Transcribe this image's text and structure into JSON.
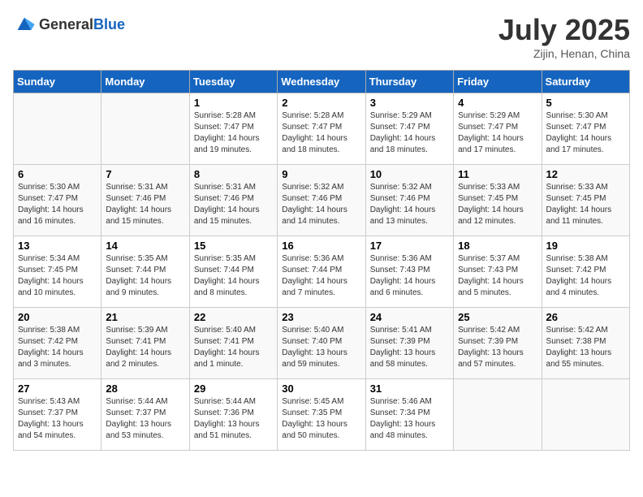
{
  "header": {
    "logo_general": "General",
    "logo_blue": "Blue",
    "title": "July 2025",
    "location": "Zijin, Henan, China"
  },
  "weekdays": [
    "Sunday",
    "Monday",
    "Tuesday",
    "Wednesday",
    "Thursday",
    "Friday",
    "Saturday"
  ],
  "weeks": [
    [
      {
        "day": "",
        "sunrise": "",
        "sunset": "",
        "daylight": ""
      },
      {
        "day": "",
        "sunrise": "",
        "sunset": "",
        "daylight": ""
      },
      {
        "day": "1",
        "sunrise": "Sunrise: 5:28 AM",
        "sunset": "Sunset: 7:47 PM",
        "daylight": "Daylight: 14 hours and 19 minutes."
      },
      {
        "day": "2",
        "sunrise": "Sunrise: 5:28 AM",
        "sunset": "Sunset: 7:47 PM",
        "daylight": "Daylight: 14 hours and 18 minutes."
      },
      {
        "day": "3",
        "sunrise": "Sunrise: 5:29 AM",
        "sunset": "Sunset: 7:47 PM",
        "daylight": "Daylight: 14 hours and 18 minutes."
      },
      {
        "day": "4",
        "sunrise": "Sunrise: 5:29 AM",
        "sunset": "Sunset: 7:47 PM",
        "daylight": "Daylight: 14 hours and 17 minutes."
      },
      {
        "day": "5",
        "sunrise": "Sunrise: 5:30 AM",
        "sunset": "Sunset: 7:47 PM",
        "daylight": "Daylight: 14 hours and 17 minutes."
      }
    ],
    [
      {
        "day": "6",
        "sunrise": "Sunrise: 5:30 AM",
        "sunset": "Sunset: 7:47 PM",
        "daylight": "Daylight: 14 hours and 16 minutes."
      },
      {
        "day": "7",
        "sunrise": "Sunrise: 5:31 AM",
        "sunset": "Sunset: 7:46 PM",
        "daylight": "Daylight: 14 hours and 15 minutes."
      },
      {
        "day": "8",
        "sunrise": "Sunrise: 5:31 AM",
        "sunset": "Sunset: 7:46 PM",
        "daylight": "Daylight: 14 hours and 15 minutes."
      },
      {
        "day": "9",
        "sunrise": "Sunrise: 5:32 AM",
        "sunset": "Sunset: 7:46 PM",
        "daylight": "Daylight: 14 hours and 14 minutes."
      },
      {
        "day": "10",
        "sunrise": "Sunrise: 5:32 AM",
        "sunset": "Sunset: 7:46 PM",
        "daylight": "Daylight: 14 hours and 13 minutes."
      },
      {
        "day": "11",
        "sunrise": "Sunrise: 5:33 AM",
        "sunset": "Sunset: 7:45 PM",
        "daylight": "Daylight: 14 hours and 12 minutes."
      },
      {
        "day": "12",
        "sunrise": "Sunrise: 5:33 AM",
        "sunset": "Sunset: 7:45 PM",
        "daylight": "Daylight: 14 hours and 11 minutes."
      }
    ],
    [
      {
        "day": "13",
        "sunrise": "Sunrise: 5:34 AM",
        "sunset": "Sunset: 7:45 PM",
        "daylight": "Daylight: 14 hours and 10 minutes."
      },
      {
        "day": "14",
        "sunrise": "Sunrise: 5:35 AM",
        "sunset": "Sunset: 7:44 PM",
        "daylight": "Daylight: 14 hours and 9 minutes."
      },
      {
        "day": "15",
        "sunrise": "Sunrise: 5:35 AM",
        "sunset": "Sunset: 7:44 PM",
        "daylight": "Daylight: 14 hours and 8 minutes."
      },
      {
        "day": "16",
        "sunrise": "Sunrise: 5:36 AM",
        "sunset": "Sunset: 7:44 PM",
        "daylight": "Daylight: 14 hours and 7 minutes."
      },
      {
        "day": "17",
        "sunrise": "Sunrise: 5:36 AM",
        "sunset": "Sunset: 7:43 PM",
        "daylight": "Daylight: 14 hours and 6 minutes."
      },
      {
        "day": "18",
        "sunrise": "Sunrise: 5:37 AM",
        "sunset": "Sunset: 7:43 PM",
        "daylight": "Daylight: 14 hours and 5 minutes."
      },
      {
        "day": "19",
        "sunrise": "Sunrise: 5:38 AM",
        "sunset": "Sunset: 7:42 PM",
        "daylight": "Daylight: 14 hours and 4 minutes."
      }
    ],
    [
      {
        "day": "20",
        "sunrise": "Sunrise: 5:38 AM",
        "sunset": "Sunset: 7:42 PM",
        "daylight": "Daylight: 14 hours and 3 minutes."
      },
      {
        "day": "21",
        "sunrise": "Sunrise: 5:39 AM",
        "sunset": "Sunset: 7:41 PM",
        "daylight": "Daylight: 14 hours and 2 minutes."
      },
      {
        "day": "22",
        "sunrise": "Sunrise: 5:40 AM",
        "sunset": "Sunset: 7:41 PM",
        "daylight": "Daylight: 14 hours and 1 minute."
      },
      {
        "day": "23",
        "sunrise": "Sunrise: 5:40 AM",
        "sunset": "Sunset: 7:40 PM",
        "daylight": "Daylight: 13 hours and 59 minutes."
      },
      {
        "day": "24",
        "sunrise": "Sunrise: 5:41 AM",
        "sunset": "Sunset: 7:39 PM",
        "daylight": "Daylight: 13 hours and 58 minutes."
      },
      {
        "day": "25",
        "sunrise": "Sunrise: 5:42 AM",
        "sunset": "Sunset: 7:39 PM",
        "daylight": "Daylight: 13 hours and 57 minutes."
      },
      {
        "day": "26",
        "sunrise": "Sunrise: 5:42 AM",
        "sunset": "Sunset: 7:38 PM",
        "daylight": "Daylight: 13 hours and 55 minutes."
      }
    ],
    [
      {
        "day": "27",
        "sunrise": "Sunrise: 5:43 AM",
        "sunset": "Sunset: 7:37 PM",
        "daylight": "Daylight: 13 hours and 54 minutes."
      },
      {
        "day": "28",
        "sunrise": "Sunrise: 5:44 AM",
        "sunset": "Sunset: 7:37 PM",
        "daylight": "Daylight: 13 hours and 53 minutes."
      },
      {
        "day": "29",
        "sunrise": "Sunrise: 5:44 AM",
        "sunset": "Sunset: 7:36 PM",
        "daylight": "Daylight: 13 hours and 51 minutes."
      },
      {
        "day": "30",
        "sunrise": "Sunrise: 5:45 AM",
        "sunset": "Sunset: 7:35 PM",
        "daylight": "Daylight: 13 hours and 50 minutes."
      },
      {
        "day": "31",
        "sunrise": "Sunrise: 5:46 AM",
        "sunset": "Sunset: 7:34 PM",
        "daylight": "Daylight: 13 hours and 48 minutes."
      },
      {
        "day": "",
        "sunrise": "",
        "sunset": "",
        "daylight": ""
      },
      {
        "day": "",
        "sunrise": "",
        "sunset": "",
        "daylight": ""
      }
    ]
  ]
}
